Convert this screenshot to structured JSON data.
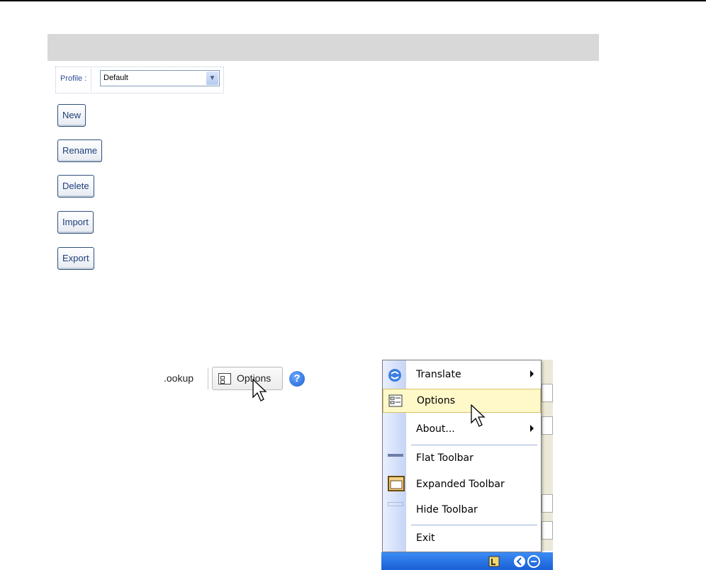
{
  "profile": {
    "label": "Profile :",
    "selected": "Default"
  },
  "buttons": {
    "new": "New",
    "rename": "Rename",
    "delete": "Delete",
    "import": "Import",
    "export": "Export"
  },
  "toolbar": {
    "lookup_text": ".ookup",
    "options_label": "Options",
    "help_glyph": "?"
  },
  "context_menu": {
    "items": [
      {
        "label": "Translate",
        "icon": "translate-icon",
        "submenu": true
      },
      {
        "label": "Options",
        "icon": "options-icon",
        "submenu": false,
        "highlighted": true
      },
      {
        "label": "About...",
        "icon": "",
        "submenu": true
      },
      {
        "label": "Flat Toolbar",
        "icon": "flat-toolbar-icon",
        "submenu": false
      },
      {
        "label": "Expanded Toolbar",
        "icon": "expanded-toolbar-icon",
        "submenu": false
      },
      {
        "label": "Hide Toolbar",
        "icon": "hide-toolbar-icon",
        "submenu": false
      },
      {
        "label": "Exit",
        "icon": "",
        "submenu": false
      }
    ]
  },
  "colors": {
    "header_band": "#d8d8d8",
    "button_text": "#1f3f7a",
    "menu_highlight": "#fff8c8",
    "taskbar": "#1a5fd6"
  }
}
